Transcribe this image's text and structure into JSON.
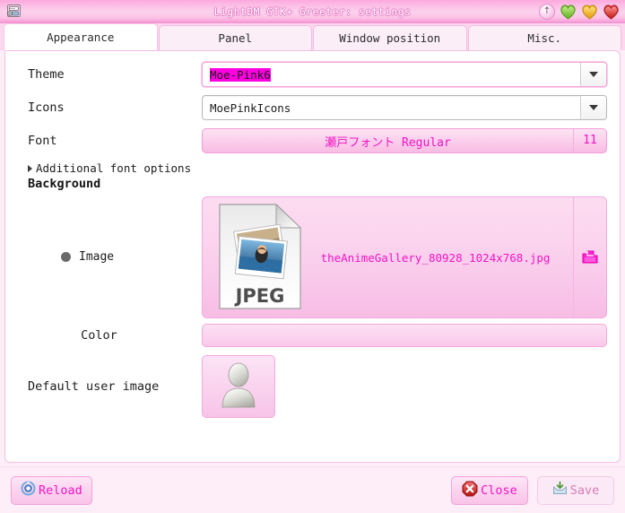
{
  "window": {
    "title": "LightDM GTK+ Greeter: settings",
    "app_icon": "settings-window-icon",
    "buttons": {
      "shade_label": "shade-arrow-up-icon",
      "minimize_label": "minimize-heart-icon",
      "maximize_label": "maximize-heart-icon",
      "close_label": "close-heart-icon"
    },
    "colors": {
      "titlebar_pink": "#fbb9e3",
      "accent_magenta": "#f214c4",
      "selection_magenta": "#ff00e0",
      "panel_white": "#ffffff",
      "body_pink": "#fdeef7"
    }
  },
  "tabs": [
    {
      "label": "Appearance",
      "active": true
    },
    {
      "label": "Panel",
      "active": false
    },
    {
      "label": "Window position",
      "active": false
    },
    {
      "label": "Misc.",
      "active": false
    }
  ],
  "appearance": {
    "theme": {
      "label": "Theme",
      "value": "Moe-Pink6",
      "selected": true,
      "focused": true
    },
    "icons": {
      "label": "Icons",
      "value": "MoePinkIcons",
      "focused": false
    },
    "font": {
      "label": "Font",
      "family": "瀬戸フォント Regular",
      "size": "11"
    },
    "additional_font_options": {
      "label": "Additional font options",
      "expanded": false
    },
    "background": {
      "heading": "Background",
      "image": {
        "label": "Image",
        "selected": true,
        "filename": "theAnimeGallery_80928_1024x768.jpg",
        "thumbnail_type": "JPEG",
        "open_icon": "open-file-icon"
      },
      "color": {
        "label": "Color",
        "value": ""
      }
    },
    "default_user_image": {
      "label": "Default user image",
      "icon": "default-avatar-icon"
    }
  },
  "actions": {
    "reload": {
      "label": "Reload",
      "icon": "reload-icon",
      "enabled": true
    },
    "close": {
      "label": "Close",
      "icon": "close-x-icon",
      "enabled": true
    },
    "save": {
      "label": "Save",
      "icon": "save-icon",
      "enabled": false
    }
  }
}
